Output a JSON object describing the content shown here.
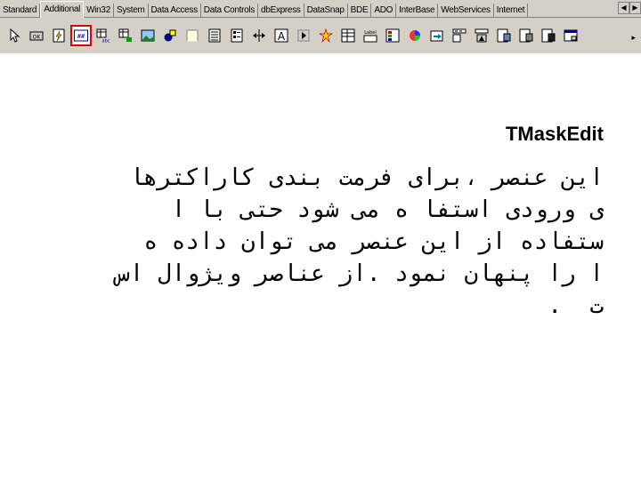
{
  "palette": {
    "tabs": [
      {
        "label": "Standard"
      },
      {
        "label": "Additional",
        "active": true
      },
      {
        "label": "Win32"
      },
      {
        "label": "System"
      },
      {
        "label": "Data Access"
      },
      {
        "label": "Data Controls"
      },
      {
        "label": "dbExpress"
      },
      {
        "label": "DataSnap"
      },
      {
        "label": "BDE"
      },
      {
        "label": "ADO"
      },
      {
        "label": "InterBase"
      },
      {
        "label": "WebServices"
      },
      {
        "label": "Internet"
      }
    ],
    "scroll_left": "◀",
    "scroll_right": "▶",
    "more": "▸",
    "tools": [
      {
        "icon": "pointer-icon"
      },
      {
        "icon": "bitbtn-ok-icon",
        "text": "OK"
      },
      {
        "icon": "speedbutton-icon"
      },
      {
        "icon": "maskedit-icon",
        "text": "##",
        "selected": true
      },
      {
        "icon": "stringgrid-icon",
        "text": "abc"
      },
      {
        "icon": "drawgrid-icon"
      },
      {
        "icon": "image-icon"
      },
      {
        "icon": "shape-icon"
      },
      {
        "icon": "bevel-icon"
      },
      {
        "icon": "scrollbox-icon"
      },
      {
        "icon": "checklistbox-icon"
      },
      {
        "icon": "splitter-icon"
      },
      {
        "icon": "statictext-icon",
        "text": "A"
      },
      {
        "icon": "controlbar-icon"
      },
      {
        "icon": "applicationevents-icon"
      },
      {
        "icon": "valuelisteditor-icon"
      },
      {
        "icon": "labelededit-icon",
        "text": "Label"
      },
      {
        "icon": "colorbox-icon"
      },
      {
        "icon": "chart-icon"
      },
      {
        "icon": "actionmanager-icon"
      },
      {
        "icon": "actionmainmenubar-icon"
      },
      {
        "icon": "actiontoolbar-icon"
      },
      {
        "icon": "xpcolormap-icon"
      },
      {
        "icon": "standardcolormap-icon"
      },
      {
        "icon": "twilightcolormap-icon"
      },
      {
        "icon": "customizedlg-icon"
      }
    ]
  },
  "content": {
    "title": "TMaskEdit",
    "lines": [
      "این عنصر ،برای فرمت بندی کاراکترها",
      "ی ورودی استفا ه می شود حتی با ا",
      "ستفاده از این عنصر می توان داده ه",
      "ا را پنهان نمود .از عناصر ویژوال اس",
      "ت  ."
    ]
  }
}
